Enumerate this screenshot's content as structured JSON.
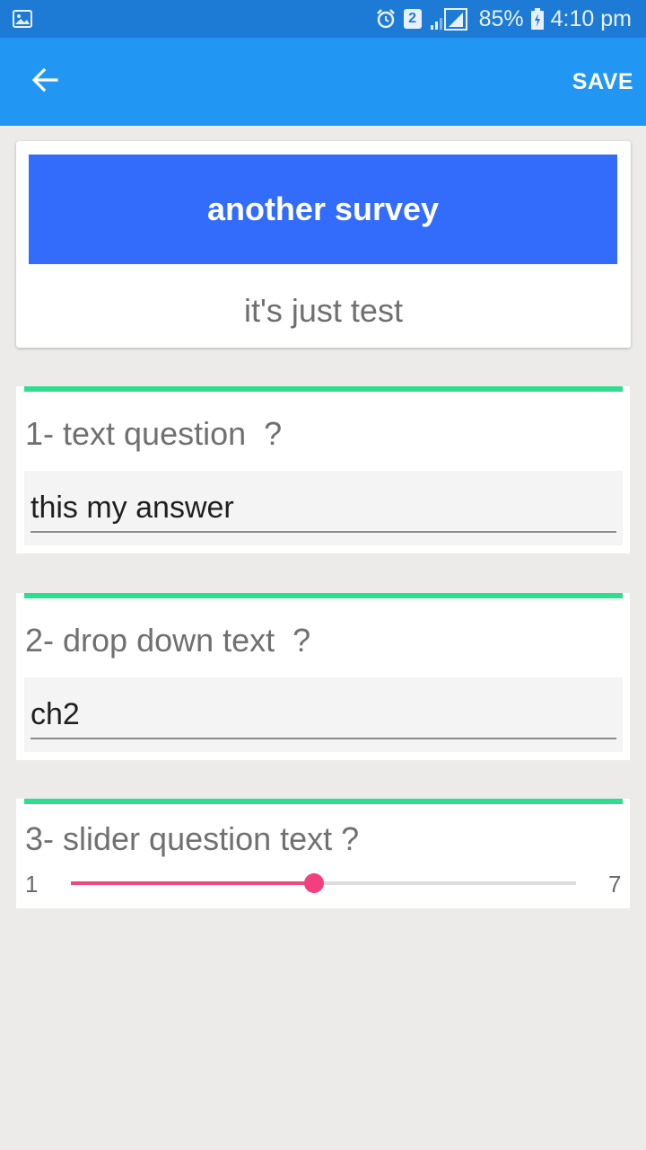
{
  "status_bar": {
    "battery": "85%",
    "time": "4:10 pm",
    "sim_badge": "2",
    "icons": [
      "image-icon",
      "alarm-icon",
      "signal-icon",
      "battery-charging-icon"
    ]
  },
  "app_bar": {
    "back_icon": "arrow-back-icon",
    "save_label": "SAVE",
    "color": "#2196f3"
  },
  "survey": {
    "title": "another survey",
    "description": "it's just test",
    "banner_color": "#336cfb"
  },
  "questions": [
    {
      "title": "1- text question  ?",
      "answer": "this my answer",
      "type": "text"
    },
    {
      "title": "2- drop down text  ?",
      "answer": "ch2",
      "type": "dropdown"
    },
    {
      "title": "3- slider question text ?",
      "type": "slider",
      "min": "1",
      "max": "7",
      "value_fraction": 0.482
    }
  ],
  "colors": {
    "accent_green": "#2ddf8c",
    "slider_pink": "#f23f7d"
  }
}
